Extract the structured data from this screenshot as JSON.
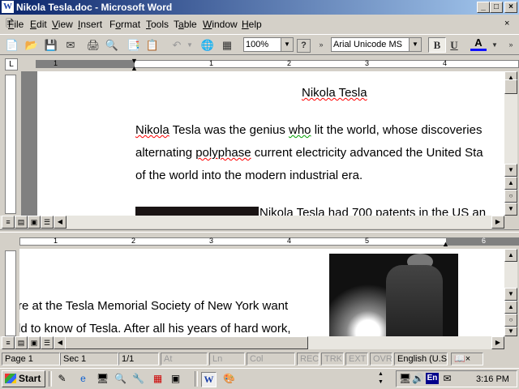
{
  "window": {
    "title": "Nikola Tesla.doc - Microsoft Word",
    "app_icon": "W"
  },
  "menu": [
    "File",
    "Edit",
    "View",
    "Insert",
    "Format",
    "Tools",
    "Table",
    "Window",
    "Help"
  ],
  "menu_accel": [
    "F",
    "E",
    "V",
    "I",
    "o",
    "T",
    "a",
    "W",
    "H"
  ],
  "toolbar": {
    "zoom": "100%",
    "font": "Arial Unicode MS",
    "bold": "B",
    "underline": "U",
    "font_color": "A"
  },
  "ruler_top_numbers": [
    "1",
    "1",
    "2",
    "3",
    "4"
  ],
  "ruler_bottom_numbers": [
    "1",
    "2",
    "3",
    "4",
    "5",
    "6"
  ],
  "document": {
    "title": "Nikola Tesla",
    "p1_line1_a": "Nikola",
    "p1_line1_b": " Tesla was the genius ",
    "p1_line1_c": "who",
    "p1_line1_d": " lit the world, whose discoveries",
    "p1_line2_a": "alternating ",
    "p1_line2_b": "polyphase",
    "p1_line2_c": " current electricity advanced the United Sta",
    "p1_line3": "of the world into the modern industrial era.",
    "p2_line1": "Nikola Tesla had 700 patents in the US an",
    "lower_line1": "re at the Tesla Memorial Society of New York want",
    "lower_line2": "ld to know of Tesla. After all his years of hard work,"
  },
  "status": {
    "page": "Page  1",
    "sec": "Sec  1",
    "pages": "1/1",
    "at": "At",
    "ln": "Ln",
    "col": "Col",
    "rec": "REC",
    "trk": "TRK",
    "ext": "EXT",
    "ovr": "OVR",
    "lang": "English (U.S"
  },
  "taskbar": {
    "start": "Start",
    "clock": "3:16 PM",
    "lang_indicator": "En"
  }
}
